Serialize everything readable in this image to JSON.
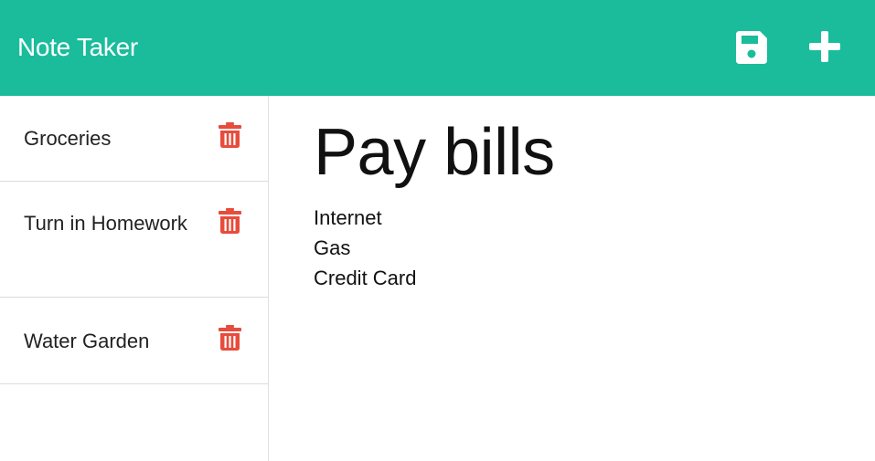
{
  "app": {
    "title": "Note Taker"
  },
  "toolbar": {
    "save_icon": "floppy-disk-icon",
    "add_icon": "plus-icon"
  },
  "notes": [
    {
      "title": "Groceries",
      "icon": "trash-icon"
    },
    {
      "title": "Turn in Homework",
      "icon": "trash-icon"
    },
    {
      "title": "Water Garden",
      "icon": "trash-icon"
    }
  ],
  "active_note": {
    "title": "Pay bills",
    "text": "Internet\nGas\nCredit Card"
  },
  "colors": {
    "navbar": "#1abc9c",
    "nav_icons": "#ffffff",
    "trash": "#e74c3c"
  }
}
